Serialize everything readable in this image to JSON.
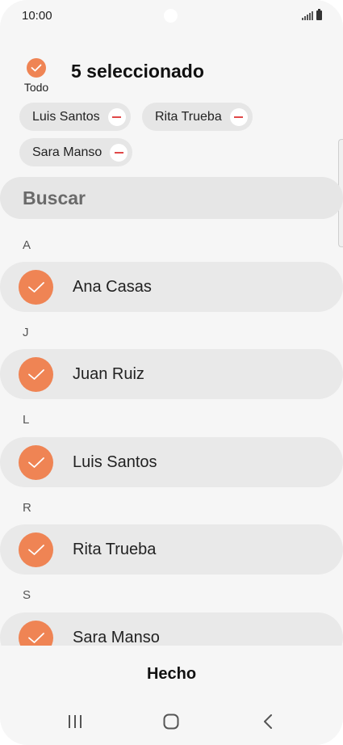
{
  "status_bar": {
    "time": "10:00",
    "icons": [
      "signal-icon",
      "battery-icon"
    ]
  },
  "selection_header": {
    "select_all_label": "Todo",
    "select_all_checked": true,
    "selected_count_text": "5 seleccionado"
  },
  "selected_chips": [
    {
      "label": "Luis Santos"
    },
    {
      "label": "Rita Trueba"
    },
    {
      "label": "Sara Manso"
    }
  ],
  "search": {
    "placeholder": "Buscar"
  },
  "contact_list": {
    "sections": [
      {
        "letter": "A",
        "contacts": [
          {
            "name": "Ana Casas",
            "checked": true
          }
        ]
      },
      {
        "letter": "J",
        "contacts": [
          {
            "name": "Juan Ruiz",
            "checked": true
          }
        ]
      },
      {
        "letter": "L",
        "contacts": [
          {
            "name": "Luis Santos",
            "checked": true
          }
        ]
      },
      {
        "letter": "R",
        "contacts": [
          {
            "name": "Rita Trueba",
            "checked": true
          }
        ]
      },
      {
        "letter": "S",
        "contacts": [
          {
            "name": "Sara Manso",
            "checked": true
          }
        ]
      }
    ]
  },
  "done_button": {
    "label": "Hecho"
  },
  "nav_bar": {
    "buttons": [
      "recent-apps-icon",
      "home-icon",
      "back-icon"
    ]
  },
  "colors": {
    "accent": "#ef8454",
    "remove": "#e04848",
    "background": "#f6f6f6",
    "row_background": "#e9e9e9"
  }
}
